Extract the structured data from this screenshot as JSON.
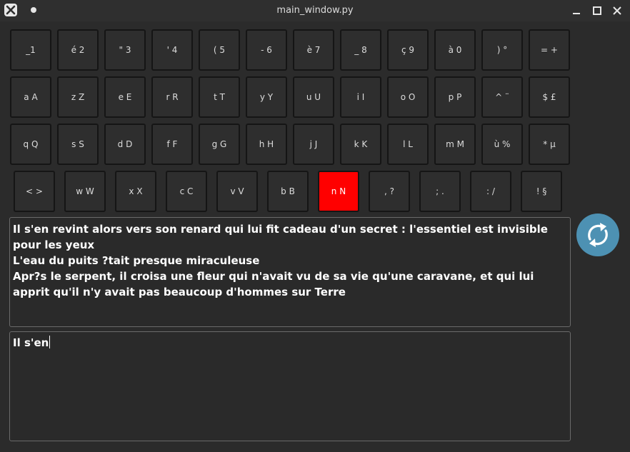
{
  "window": {
    "title": "main_window.py"
  },
  "keyboard": {
    "active_key": "n N",
    "rows": [
      [
        "_1",
        "é 2",
        "\" 3",
        "' 4",
        "( 5",
        "- 6",
        "è 7",
        "_ 8",
        "ç 9",
        "à 0",
        ") °",
        "= +"
      ],
      [
        "a A",
        "z Z",
        "e E",
        "r R",
        "t T",
        "y Y",
        "u U",
        "i I",
        "o O",
        "p P",
        "^ ¨",
        "$ £"
      ],
      [
        "q Q",
        "s S",
        "d D",
        "f F",
        "g G",
        "h H",
        "j J",
        "k K",
        "l L",
        "m M",
        "ù %",
        "* µ"
      ],
      [
        "< >",
        "w W",
        "x X",
        "c C",
        "v V",
        "b B",
        "n N",
        ", ?",
        "; .",
        ": /",
        "! §"
      ]
    ]
  },
  "reference_text": {
    "lines": [
      "Il s'en revint alors vers son renard qui lui fit cadeau d'un secret : l'essentiel est invisible pour les yeux",
      "L'eau du puits ?tait presque miraculeuse",
      "Apr?s le serpent, il croisa une fleur qui n'avait vu de sa vie qu'une caravane, et qui lui apprit qu'il n'y avait pas beaucoup d'hommes sur Terre"
    ]
  },
  "typed_text": {
    "value": "Il s'en"
  },
  "colors": {
    "active_key": "#ff0000",
    "refresh_button": "#4d91b3",
    "background": "#2b2b2b"
  },
  "icons": {
    "app": "x-app-icon",
    "refresh": "refresh-icon"
  }
}
